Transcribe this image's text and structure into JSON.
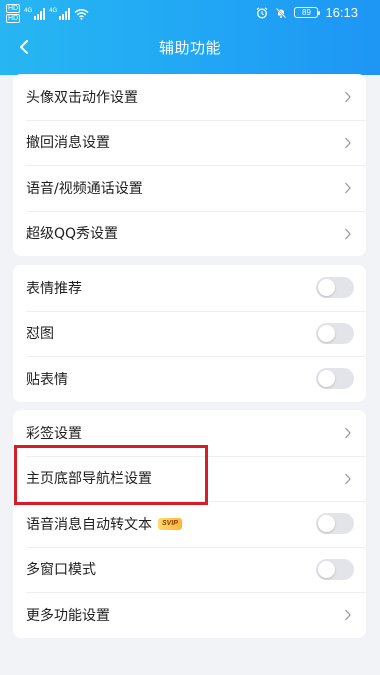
{
  "status_bar": {
    "hd_badges": [
      "HD",
      "HD"
    ],
    "signal_labels": [
      "4G",
      "4G"
    ],
    "battery": "89",
    "time": "16:13",
    "icons": [
      "alarm-icon",
      "mute-icon",
      "wifi-icon",
      "signal-icon"
    ]
  },
  "nav": {
    "title": "辅助功能",
    "back_icon": "chevron-left-icon"
  },
  "group1": [
    {
      "label": "头像双击动作设置"
    },
    {
      "label": "撤回消息设置"
    },
    {
      "label": "语音/视频通话设置"
    },
    {
      "label": "超级QQ秀设置"
    }
  ],
  "group2": [
    {
      "label": "表情推荐",
      "toggle": false
    },
    {
      "label": "怼图",
      "toggle": false
    },
    {
      "label": "贴表情",
      "toggle": false
    }
  ],
  "group3": [
    {
      "label": "彩签设置"
    },
    {
      "label": "主页底部导航栏设置"
    },
    {
      "label": "语音消息自动转文本",
      "badge": "SVIP",
      "toggle": false
    },
    {
      "label": "多窗口模式",
      "toggle": false
    },
    {
      "label": "更多功能设置"
    }
  ],
  "colors": {
    "header": "#21a6f5",
    "background": "#f2f3f7",
    "highlight": "#d51f28",
    "toggle_off": "#e3e4e9"
  }
}
